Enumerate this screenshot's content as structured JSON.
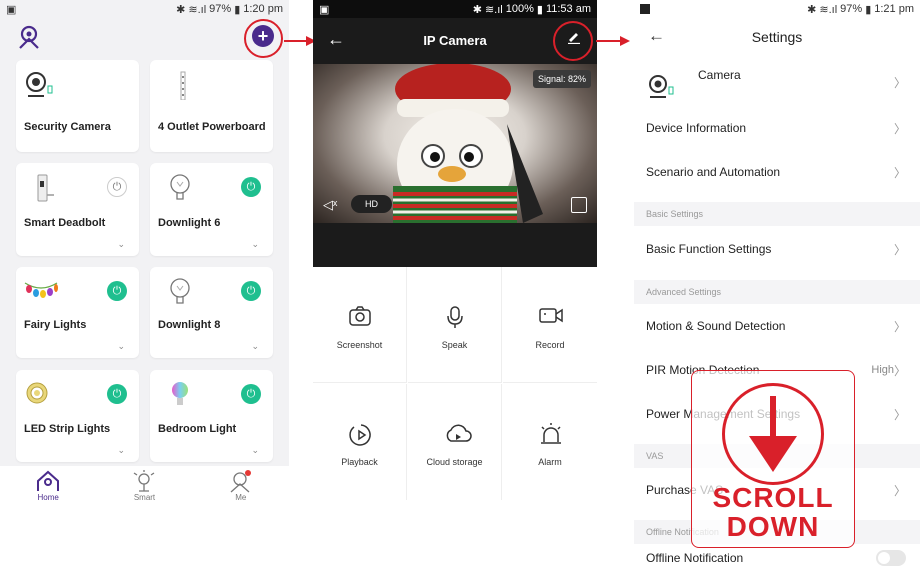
{
  "panel1": {
    "status": {
      "battery": "97%",
      "time": "1:20 pm"
    },
    "cards": [
      {
        "title": "Security Camera",
        "icon": "camera-icon"
      },
      {
        "title": "4 Outlet Powerboard",
        "icon": "powerboard-icon"
      },
      {
        "title": "Smart Deadbolt",
        "icon": "deadbolt-icon",
        "power": "off"
      },
      {
        "title": "Downlight 6",
        "icon": "bulb-icon",
        "power": "on"
      },
      {
        "title": "Fairy Lights",
        "icon": "fairy-lights-icon",
        "power": "on"
      },
      {
        "title": "Downlight 8",
        "icon": "bulb-icon",
        "power": "on"
      },
      {
        "title": "LED Strip Lights",
        "icon": "led-strip-icon",
        "power": "on"
      },
      {
        "title": "Bedroom Light",
        "icon": "color-bulb-icon",
        "power": "on"
      }
    ],
    "tabs": [
      {
        "label": "Home",
        "icon": "home-icon"
      },
      {
        "label": "Smart",
        "icon": "smart-icon"
      },
      {
        "label": "Me",
        "icon": "me-icon"
      }
    ],
    "accent": "#4a2b8c",
    "power_on_color": "#1fbf8f"
  },
  "panel2": {
    "status": {
      "battery": "100%",
      "time": "11:53 am"
    },
    "title": "IP Camera",
    "signal": "Signal: 82%",
    "quality": "HD",
    "actions": [
      {
        "label": "Screenshot",
        "icon": "camera-outline-icon"
      },
      {
        "label": "Speak",
        "icon": "microphone-icon"
      },
      {
        "label": "Record",
        "icon": "video-icon"
      },
      {
        "label": "Playback",
        "icon": "playback-icon"
      },
      {
        "label": "Cloud storage",
        "icon": "cloud-play-icon"
      },
      {
        "label": "Alarm",
        "icon": "alarm-icon"
      }
    ]
  },
  "panel3": {
    "status": {
      "battery": "97%",
      "time": "1:21 pm"
    },
    "title": "Settings",
    "device_name": "Camera",
    "rows_top": [
      "Device Information",
      "Scenario and Automation"
    ],
    "section_basic": "Basic Settings",
    "row_basic": "Basic Function Settings",
    "section_advanced": "Advanced Settings",
    "rows_advanced": [
      "Motion & Sound Detection",
      "PIR Motion Detection",
      "Power Management Settings"
    ],
    "pir_value": "High",
    "section_vas": "VAS",
    "row_vas": "Purchase VAS",
    "section_offline": "Offline Notification",
    "row_offline": "Offline Notification"
  },
  "overlay": {
    "scroll_line1": "SCROLL",
    "scroll_line2": "DOWN",
    "color": "#d9202a"
  }
}
